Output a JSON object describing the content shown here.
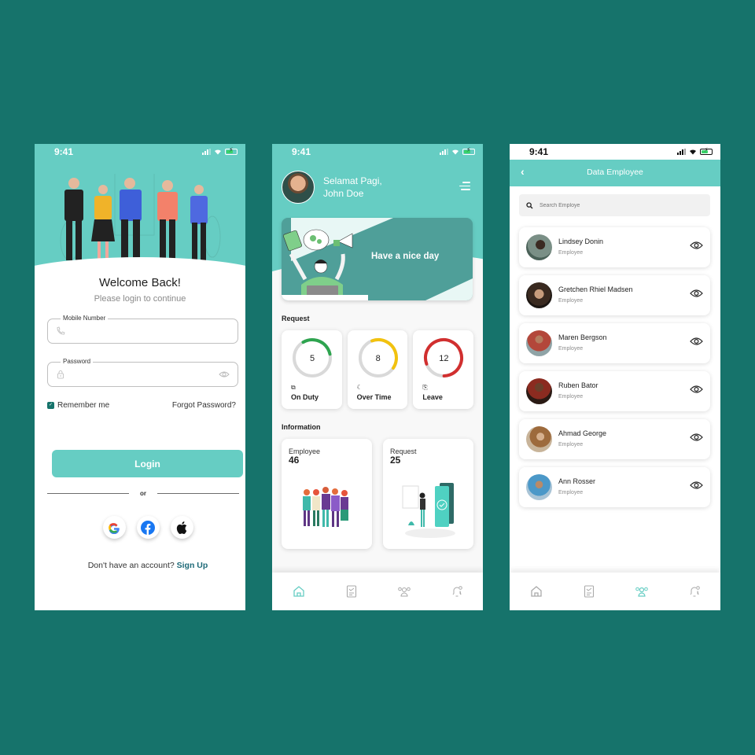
{
  "colors": {
    "background": "#16736b",
    "primary": "#66cdc3",
    "banner": "#4f9f99",
    "on_duty": "#2ea44f",
    "over_time": "#f2c20f",
    "leave": "#d12f2f",
    "link": "#1e6a78"
  },
  "status_bar": {
    "time": "9:41"
  },
  "login": {
    "title": "Welcome Back!",
    "subtitle": "Please login to continue",
    "mobile": {
      "label": "Mobile Number",
      "value": "",
      "placeholder": ""
    },
    "password": {
      "label": "Password",
      "value": "",
      "placeholder": ""
    },
    "remember_me": {
      "label": "Remember me",
      "checked": true
    },
    "forgot_password": "Forgot Password?",
    "login_button": "Login",
    "or_text": "or",
    "social": [
      {
        "name": "google",
        "icon": "google-icon"
      },
      {
        "name": "facebook",
        "icon": "facebook-icon"
      },
      {
        "name": "apple",
        "icon": "apple-icon"
      }
    ],
    "signup_prompt": "Don't have an account?",
    "signup_link": "Sign Up"
  },
  "home": {
    "greeting_line1": "Selamat Pagi,",
    "greeting_line2": "John Doe",
    "banner_text": "Have a nice day",
    "request_title": "Request",
    "requests": [
      {
        "label": "On Duty",
        "value": "5",
        "icon": "briefcase-clock-icon",
        "progress": 0.3
      },
      {
        "label": "Over Time",
        "value": "8",
        "icon": "moon-icon",
        "progress": 0.4
      },
      {
        "label": "Leave",
        "value": "12",
        "icon": "exit-door-icon",
        "progress": 0.8
      }
    ],
    "information_title": "Information",
    "information": [
      {
        "label": "Employee",
        "value": "46"
      },
      {
        "label": "Request",
        "value": "25"
      }
    ]
  },
  "bottom_nav": [
    {
      "name": "home",
      "icon": "home-icon"
    },
    {
      "name": "tasks",
      "icon": "clipboard-check-icon"
    },
    {
      "name": "employees",
      "icon": "users-icon"
    },
    {
      "name": "notifications",
      "icon": "bell-icon"
    }
  ],
  "employee_screen": {
    "title": "Data Employee",
    "search_placeholder": "Search Employe",
    "employees": [
      {
        "name": "Lindsey Donin",
        "role": "Employee"
      },
      {
        "name": "Gretchen Rhiel Madsen",
        "role": "Employee"
      },
      {
        "name": "Maren Bergson",
        "role": "Employee"
      },
      {
        "name": "Ruben Bator",
        "role": "Employee"
      },
      {
        "name": "Ahmad George",
        "role": "Employee"
      },
      {
        "name": "Ann Rosser",
        "role": "Employee"
      }
    ]
  }
}
